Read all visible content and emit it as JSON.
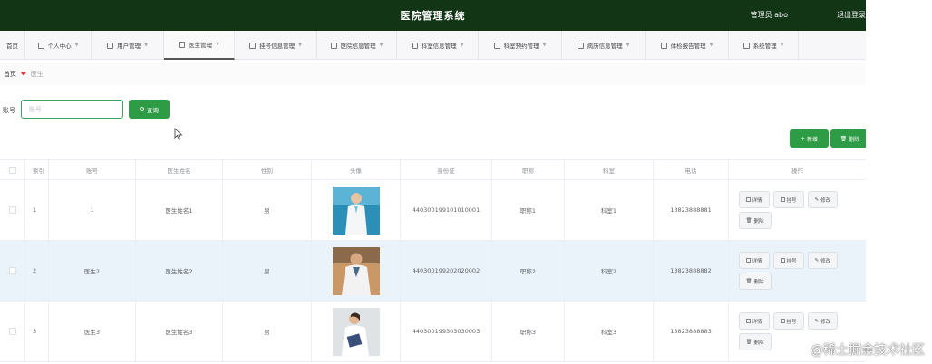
{
  "header": {
    "title": "医院管理系统",
    "user": "管理员 abo",
    "logout": "退出登录"
  },
  "nav": [
    {
      "label": "首页",
      "icon": "home-icon"
    },
    {
      "label": "个人中心",
      "icon": "person-icon"
    },
    {
      "label": "用户管理",
      "icon": "users-icon"
    },
    {
      "label": "医生管理",
      "icon": "doctor-icon",
      "active": true
    },
    {
      "label": "挂号信息管理",
      "icon": "register-icon"
    },
    {
      "label": "医院信息管理",
      "icon": "hospital-icon"
    },
    {
      "label": "科室信息管理",
      "icon": "department-icon"
    },
    {
      "label": "科室预约管理",
      "icon": "appointment-icon"
    },
    {
      "label": "病历信息管理",
      "icon": "record-icon"
    },
    {
      "label": "体检报告管理",
      "icon": "report-icon"
    },
    {
      "label": "系统管理",
      "icon": "system-icon"
    }
  ],
  "breadcrumb": {
    "home": "首页",
    "current": "医生"
  },
  "search": {
    "label": "账号",
    "placeholder": "账号",
    "button": "查询"
  },
  "actions": {
    "add": "新增",
    "delete": "删除"
  },
  "table": {
    "headers": [
      "索引",
      "账号",
      "医生姓名",
      "性别",
      "头像",
      "身份证",
      "职称",
      "科室",
      "电话",
      "操作"
    ],
    "rows": [
      {
        "index": "1",
        "account": "1",
        "name": "医生姓名1",
        "sex": "男",
        "id": "440300199101010001",
        "title": "职称1",
        "dept": "科室1",
        "phone": "13823888881"
      },
      {
        "index": "2",
        "account": "医生2",
        "name": "医生姓名2",
        "sex": "男",
        "id": "440300199202020002",
        "title": "职称2",
        "dept": "科室2",
        "phone": "13823888882"
      },
      {
        "index": "3",
        "account": "医生3",
        "name": "医生姓名3",
        "sex": "男",
        "id": "440300199303030003",
        "title": "职称3",
        "dept": "科室3",
        "phone": "13823888883"
      }
    ],
    "row_ops": [
      "详情",
      "挂号",
      "修改",
      "删除"
    ]
  },
  "watermark": "@稀土掘金技术社区",
  "colors": {
    "header_bg": "#123516",
    "accent_green": "#2e9b45",
    "danger": "#e0323a"
  }
}
